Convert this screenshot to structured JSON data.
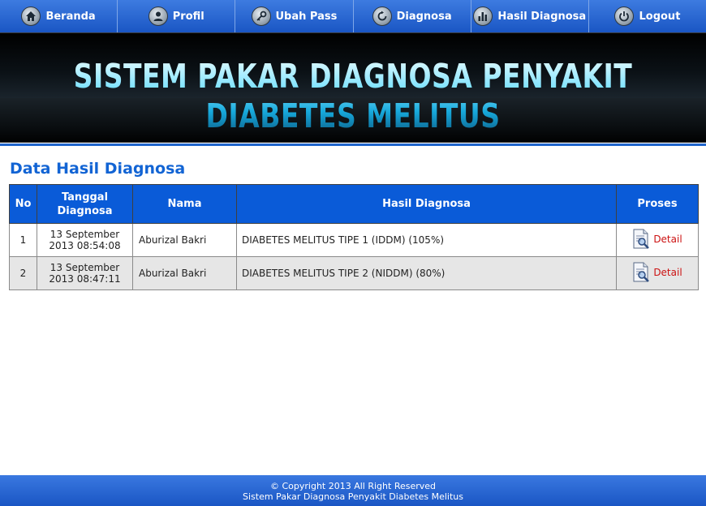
{
  "nav": {
    "items": [
      {
        "label": "Beranda",
        "icon": "home-icon"
      },
      {
        "label": "Profil",
        "icon": "user-icon"
      },
      {
        "label": "Ubah Pass",
        "icon": "key-icon"
      },
      {
        "label": "Diagnosa",
        "icon": "refresh-icon"
      },
      {
        "label": "Hasil Diagnosa",
        "icon": "bar-chart-icon"
      },
      {
        "label": "Logout",
        "icon": "power-icon"
      }
    ]
  },
  "banner": {
    "title": "SISTEM PAKAR DIAGNOSA PENYAKIT DIABETES MELITUS"
  },
  "main": {
    "title": "Data Hasil Diagnosa",
    "table": {
      "headers": {
        "no": "No",
        "tanggal_line1": "Tanggal",
        "tanggal_line2": "Diagnosa",
        "nama": "Nama",
        "hasil": "Hasil Diagnosa",
        "proses": "Proses"
      },
      "rows": [
        {
          "no": "1",
          "tanggal_line1": "13 September",
          "tanggal_line2": "2013 08:54:08",
          "nama": "Aburizal Bakri",
          "hasil": "DIABETES MELITUS TIPE 1 (IDDM) (105%)",
          "action": "Detail"
        },
        {
          "no": "2",
          "tanggal_line1": "13 September",
          "tanggal_line2": "2013 08:47:11",
          "nama": "Aburizal Bakri",
          "hasil": "DIABETES MELITUS TIPE 2 (NIDDM) (80%)",
          "action": "Detail"
        }
      ]
    }
  },
  "footer": {
    "line1": "© Copyright 2013 All Right Reserved",
    "line2": "Sistem Pakar Diagnosa Penyakit Diabetes Melitus"
  },
  "colors": {
    "accent": "#0a5bd8",
    "title": "#1264d4",
    "detail_link": "#cc1111"
  }
}
